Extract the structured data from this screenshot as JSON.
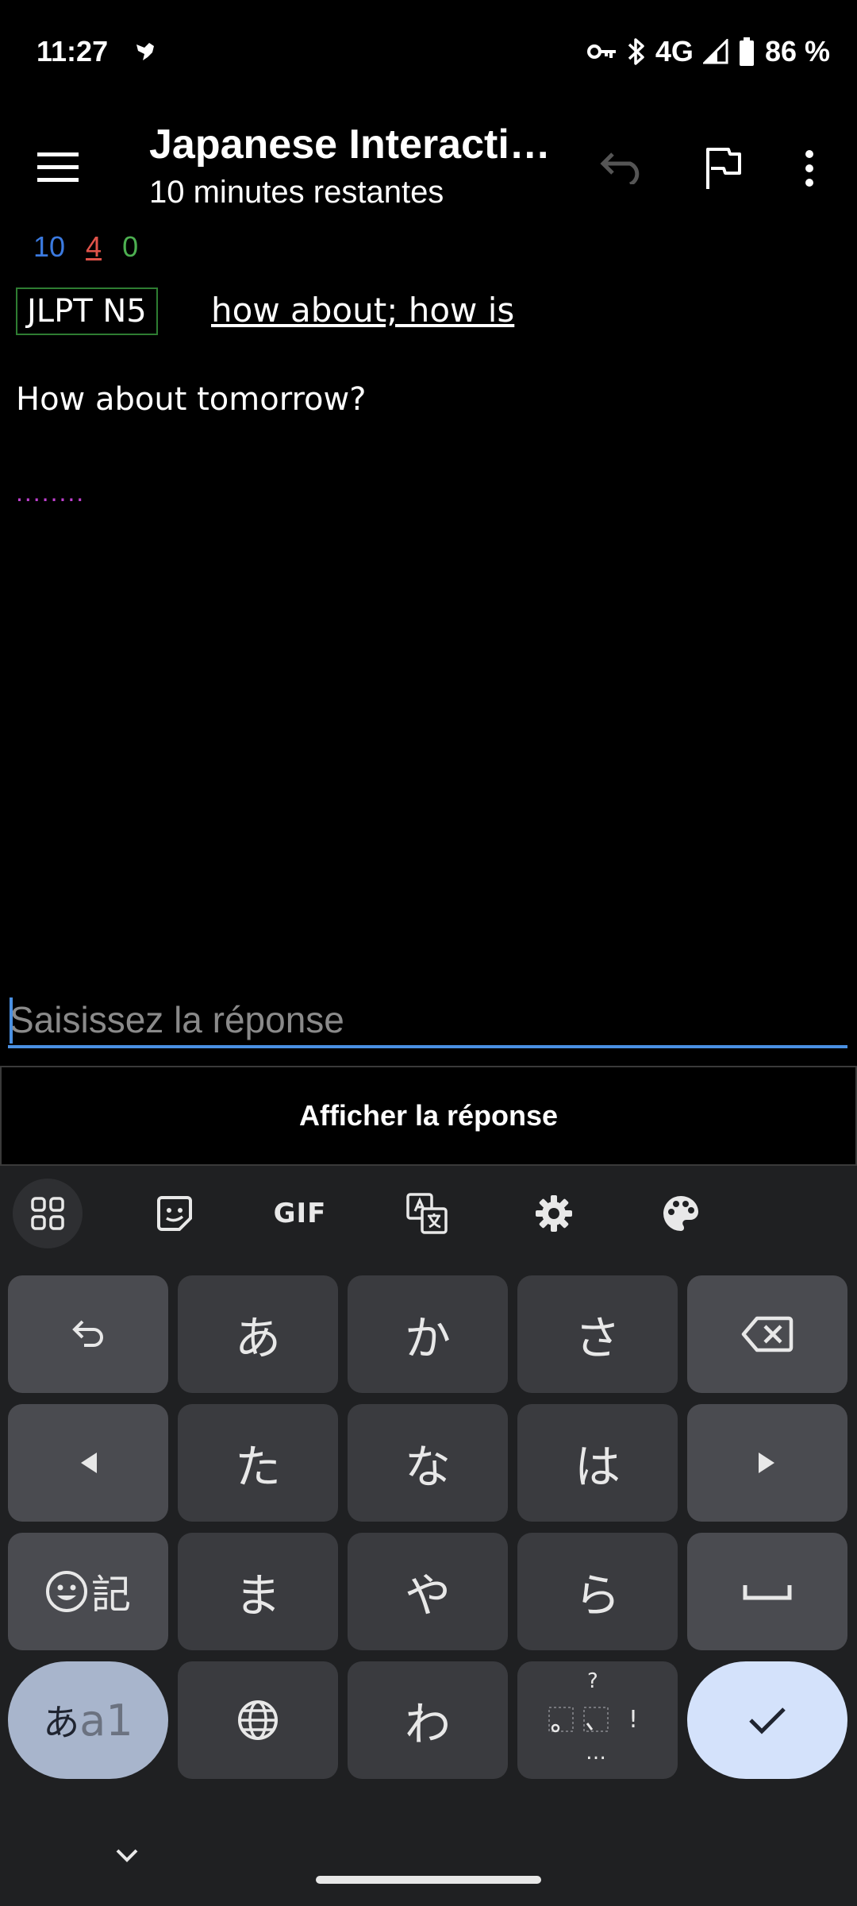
{
  "status_bar": {
    "time": "11:27",
    "network": "4G",
    "battery": "86 %"
  },
  "app_bar": {
    "title": "Japanese Interactiv…",
    "subtitle": "10 minutes restantes"
  },
  "counts": {
    "new": "10",
    "learning": "4",
    "review": "0"
  },
  "card": {
    "tag": "JLPT N5",
    "meaning": "how about; how is",
    "sentence": "How about tomorrow?",
    "dots": "........"
  },
  "answer": {
    "placeholder": "Saisissez la réponse",
    "value": ""
  },
  "show_answer_label": "Afficher la réponse",
  "keyboard": {
    "toolbar": {
      "gif_label": "GIF"
    },
    "keys": {
      "a": "あ",
      "ka": "か",
      "sa": "さ",
      "ta": "た",
      "na": "な",
      "ha": "は",
      "ma": "ま",
      "ya": "や",
      "ra": "ら",
      "wa": "わ",
      "kigou": "記",
      "mode_kana": "あ",
      "mode_alpha": "a1",
      "punct_q": "?",
      "punct_ex": "!",
      "punct_ellipsis": "…"
    }
  },
  "colors": {
    "new": "#3b7ae0",
    "learning": "#e0534a",
    "review": "#4caf50",
    "accent": "#4a90e2",
    "tag_border": "#2e7d32",
    "dots": "#c040d0"
  }
}
